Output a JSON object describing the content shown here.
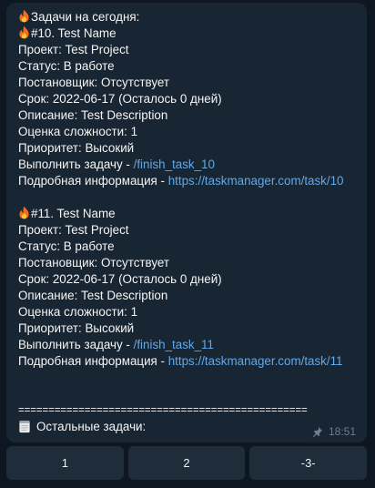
{
  "message": {
    "header": "Задачи на сегодня:",
    "tasks": [
      {
        "title": "#10. Test Name",
        "project": "Проект: Test Project",
        "status": "Статус: В работе",
        "assigner": "Постановщик: Отсутствует",
        "deadline": "Срок: 2022-06-17 (Осталось 0 дней)",
        "description": "Описание: Test Description",
        "complexity": "Оценка сложности: 1",
        "priority": "Приоритет: Высокий",
        "finish_prefix": "Выполнить задачу - ",
        "finish_command": "/finish_task_10",
        "details_prefix": "Подробная информация - ",
        "details_url": "https://taskmanager.com/task/10"
      },
      {
        "title": "#11. Test Name",
        "project": "Проект: Test Project",
        "status": "Статус: В работе",
        "assigner": "Постановщик: Отсутствует",
        "deadline": "Срок: 2022-06-17 (Осталось 0 дней)",
        "description": "Описание: Test Description",
        "complexity": "Оценка сложности: 1",
        "priority": "Приоритет: Высокий",
        "finish_prefix": "Выполнить задачу - ",
        "finish_command": "/finish_task_11",
        "details_prefix": "Подробная информация - ",
        "details_url": "https://taskmanager.com/task/11"
      }
    ],
    "separator": "================================================",
    "other_tasks": "Остальные задачи:",
    "time": "18:51"
  },
  "keyboard": {
    "buttons": [
      "1",
      "2",
      "-3-"
    ]
  },
  "colors": {
    "background": "#0e1621",
    "bubble": "#182533",
    "link": "#62a8e6",
    "button": "#1f2d3b"
  },
  "icons": {
    "task_marker": "fire-icon",
    "list_marker": "notepad-icon",
    "pinned": "pin-icon"
  }
}
